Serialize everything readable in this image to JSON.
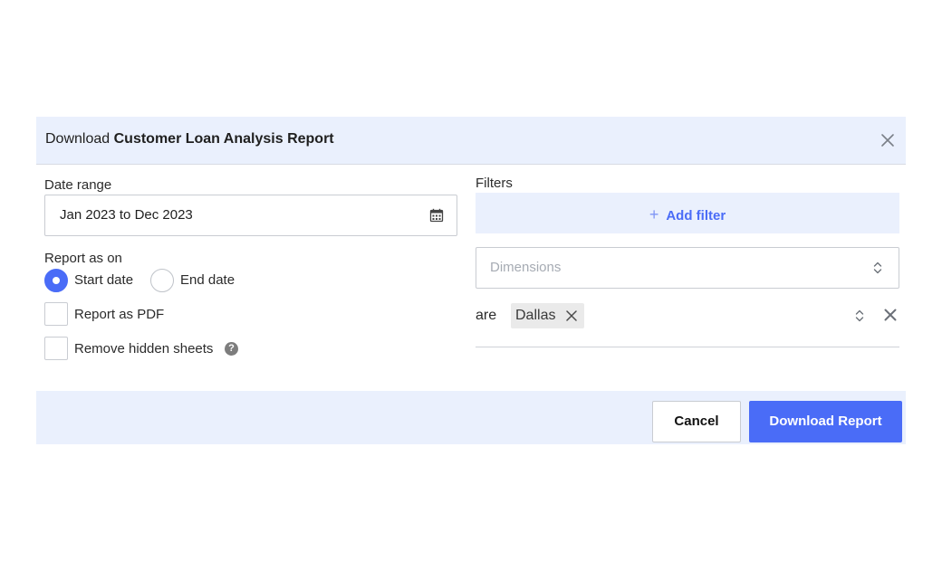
{
  "dialog": {
    "title_prefix": "Download",
    "title_name": "Customer Loan Analysis Report"
  },
  "date_range": {
    "label": "Date range",
    "value": "Jan 2023 to Dec 2023"
  },
  "report_as_on": {
    "label": "Report as on",
    "options": [
      {
        "label": "Start date",
        "selected": true
      },
      {
        "label": "End date",
        "selected": false
      }
    ]
  },
  "options": {
    "pdf_label": "Report as PDF",
    "hidden_label": "Remove hidden sheets",
    "help_glyph": "?"
  },
  "filters": {
    "label": "Filters",
    "add_label": "Add filter",
    "add_glyph": "+",
    "dimensions_placeholder": "Dimensions",
    "operator": "are",
    "chip": "Dallas"
  },
  "footer": {
    "cancel_label": "Cancel",
    "download_label": "Download Report"
  },
  "colors": {
    "accent": "#4a6cf7",
    "header_bg": "#eaf0fd"
  }
}
